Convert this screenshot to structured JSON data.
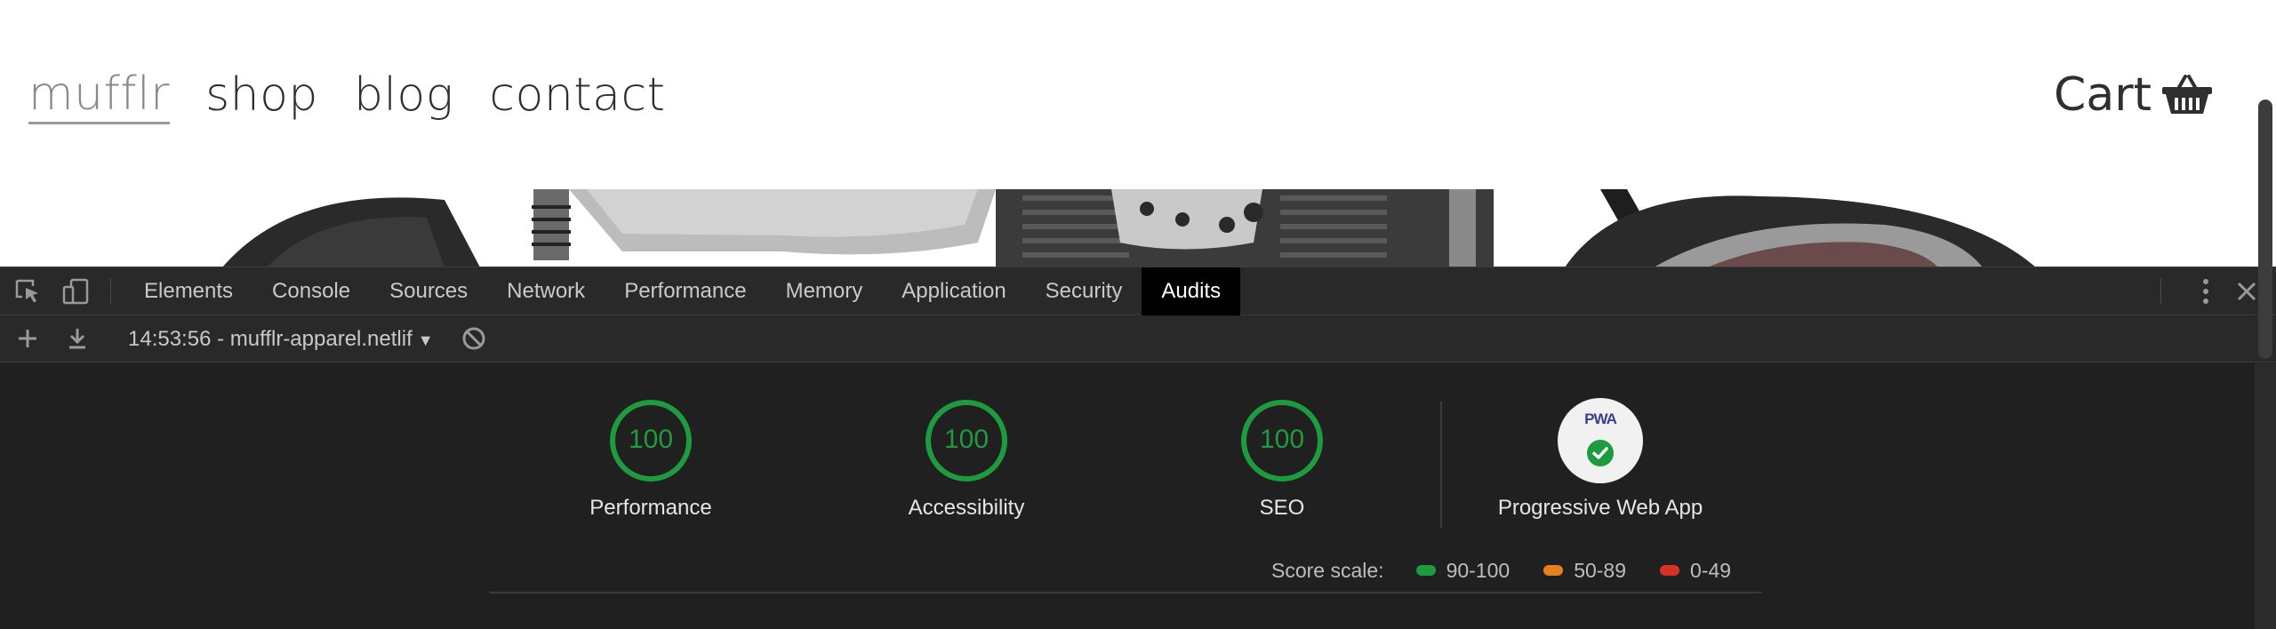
{
  "site": {
    "nav": [
      "mufflr",
      "shop",
      "blog",
      "contact"
    ],
    "cart_label": "Cart",
    "cart_icon": "basket-icon"
  },
  "devtools": {
    "tabs": [
      "Elements",
      "Console",
      "Sources",
      "Network",
      "Performance",
      "Memory",
      "Application",
      "Security",
      "Audits"
    ],
    "active_tab": "Audits",
    "toolbar": {
      "report_select": "14:53:56 - mufflr-apparel.netlif",
      "icons": [
        "plus-icon",
        "download-icon",
        "block-icon"
      ]
    },
    "scores": [
      {
        "label": "Performance",
        "value": "100"
      },
      {
        "label": "Accessibility",
        "value": "100"
      },
      {
        "label": "SEO",
        "value": "100"
      }
    ],
    "pwa": {
      "badge_text": "PWA",
      "label": "Progressive Web App"
    },
    "score_scale": {
      "title": "Score scale:",
      "ranges": [
        {
          "label": "90-100",
          "color": "#1e9b3f"
        },
        {
          "label": "50-89",
          "color": "#e67e22"
        },
        {
          "label": "0-49",
          "color": "#d93025"
        }
      ]
    },
    "colors": {
      "pass": "#1e9b3f",
      "active_tab_bg": "#000000"
    }
  }
}
